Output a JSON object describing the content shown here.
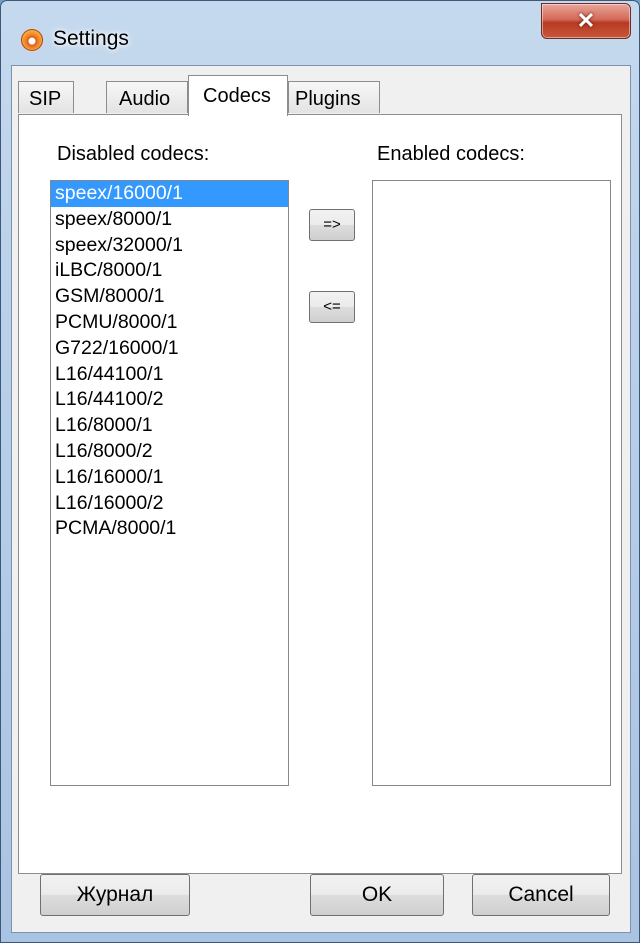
{
  "window": {
    "title": "Settings",
    "app_icon": "app-logo-icon",
    "close_label": "✕"
  },
  "tabs": [
    {
      "label": "SIP"
    },
    {
      "label": "Audio"
    },
    {
      "label": "Codecs",
      "active": true
    },
    {
      "label": "Plugins"
    }
  ],
  "codecs": {
    "disabled_label": "Disabled codecs:",
    "enabled_label": "Enabled codecs:",
    "disabled_items": [
      "speex/16000/1",
      "speex/8000/1",
      "speex/32000/1",
      "iLBC/8000/1",
      "GSM/8000/1",
      "PCMU/8000/1",
      "G722/16000/1",
      "L16/44100/1",
      "L16/44100/2",
      "L16/8000/1",
      "L16/8000/2",
      "L16/16000/1",
      "L16/16000/2",
      "PCMA/8000/1"
    ],
    "selected_item": "speex/16000/1",
    "enabled_items": [],
    "move_right_label": "=>",
    "move_left_label": "<="
  },
  "footer": {
    "log_label": "Журнал",
    "ok_label": "OK",
    "cancel_label": "Cancel"
  },
  "colors": {
    "selection": "#3399ff",
    "close_button": "#c8573a"
  }
}
